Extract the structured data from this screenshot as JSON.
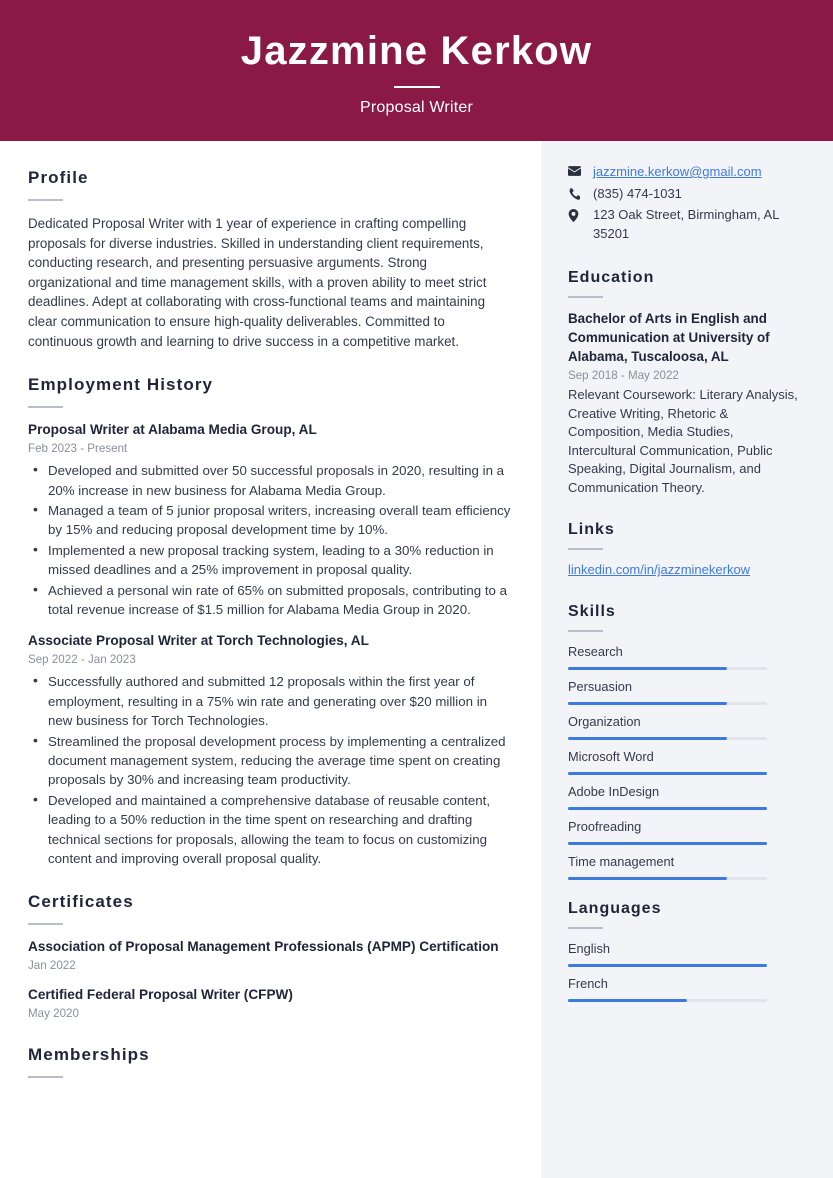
{
  "header": {
    "name": "Jazzmine Kerkow",
    "title": "Proposal Writer"
  },
  "colors": {
    "header_bg": "#8a1a45",
    "sidebar_bg": "#f3f4f7",
    "accent_blue": "#3d7ae0",
    "rule_gray": "#b9bdc9",
    "text_dark": "#202639",
    "text_body": "#343a4c",
    "text_muted": "#8b8f9c"
  },
  "main": {
    "profile": {
      "heading": "Profile",
      "text": "Dedicated Proposal Writer with 1 year of experience in crafting compelling proposals for diverse industries. Skilled in understanding client requirements, conducting research, and presenting persuasive arguments. Strong organizational and time management skills, with a proven ability to meet strict deadlines. Adept at collaborating with cross-functional teams and maintaining clear communication to ensure high-quality deliverables. Committed to continuous growth and learning to drive success in a competitive market."
    },
    "employment": {
      "heading": "Employment History",
      "entries": [
        {
          "title": "Proposal Writer at Alabama Media Group, AL",
          "date": "Feb 2023 - Present",
          "bullets": [
            "Developed and submitted over 50 successful proposals in 2020, resulting in a 20% increase in new business for Alabama Media Group.",
            "Managed a team of 5 junior proposal writers, increasing overall team efficiency by 15% and reducing proposal development time by 10%.",
            "Implemented a new proposal tracking system, leading to a 30% reduction in missed deadlines and a 25% improvement in proposal quality.",
            "Achieved a personal win rate of 65% on submitted proposals, contributing to a total revenue increase of $1.5 million for Alabama Media Group in 2020."
          ]
        },
        {
          "title": "Associate Proposal Writer at Torch Technologies, AL",
          "date": "Sep 2022 - Jan 2023",
          "bullets": [
            "Successfully authored and submitted 12 proposals within the first year of employment, resulting in a 75% win rate and generating over $20 million in new business for Torch Technologies.",
            "Streamlined the proposal development process by implementing a centralized document management system, reducing the average time spent on creating proposals by 30% and increasing team productivity.",
            "Developed and maintained a comprehensive database of reusable content, leading to a 50% reduction in the time spent on researching and drafting technical sections for proposals, allowing the team to focus on customizing content and improving overall proposal quality."
          ]
        }
      ]
    },
    "certificates": {
      "heading": "Certificates",
      "entries": [
        {
          "title": "Association of Proposal Management Professionals (APMP) Certification",
          "date": "Jan 2022"
        },
        {
          "title": "Certified Federal Proposal Writer (CFPW)",
          "date": "May 2020"
        }
      ]
    },
    "memberships": {
      "heading": "Memberships"
    }
  },
  "sidebar": {
    "contact": [
      {
        "icon": "envelope-icon",
        "value": "jazzmine.kerkow@gmail.com",
        "is_link": true
      },
      {
        "icon": "phone-icon",
        "value": "(835) 474-1031",
        "is_link": false
      },
      {
        "icon": "location-pin-icon",
        "value": "123 Oak Street, Birmingham, AL 35201",
        "is_link": false
      }
    ],
    "education": {
      "heading": "Education",
      "degree": "Bachelor of Arts in English and Communication at University of Alabama, Tuscaloosa, AL",
      "date": "Sep 2018 - May 2022",
      "description": "Relevant Coursework: Literary Analysis, Creative Writing, Rhetoric & Composition, Media Studies, Intercultural Communication, Public Speaking, Digital Journalism, and Communication Theory."
    },
    "links": {
      "heading": "Links",
      "items": [
        {
          "label": "linkedin.com/in/jazzminekerkow"
        }
      ]
    },
    "skills": {
      "heading": "Skills",
      "items": [
        {
          "label": "Research",
          "level": 80
        },
        {
          "label": "Persuasion",
          "level": 80
        },
        {
          "label": "Organization",
          "level": 80
        },
        {
          "label": "Microsoft Word",
          "level": 100
        },
        {
          "label": "Adobe InDesign",
          "level": 100
        },
        {
          "label": "Proofreading",
          "level": 100
        },
        {
          "label": "Time management",
          "level": 80
        }
      ]
    },
    "languages": {
      "heading": "Languages",
      "items": [
        {
          "label": "English",
          "level": 100
        },
        {
          "label": "French",
          "level": 60
        }
      ]
    }
  }
}
